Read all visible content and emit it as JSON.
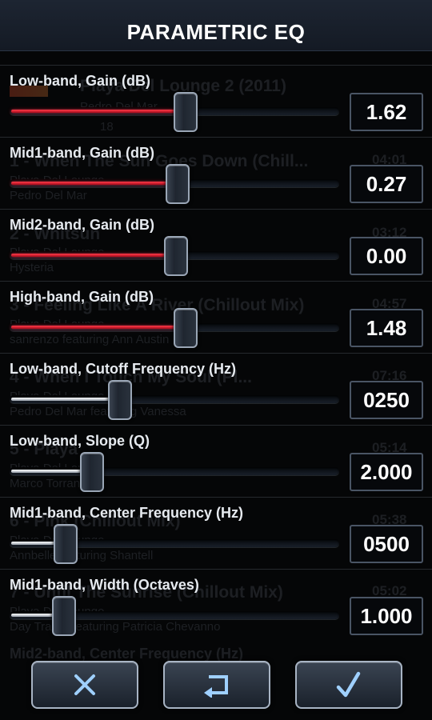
{
  "header": {
    "title": "PARAMETRIC EQ"
  },
  "background_playlist": {
    "album": "Playa Del Lounge 2 (2011)",
    "album_meta_1": "Pedro Del Mar",
    "album_meta_2": "18",
    "tracks": [
      {
        "title": "1 - When The Sun Goes Down (Chill...",
        "line2": "Playa Del Lounge",
        "artist": "Pedro Del Mar",
        "duration": "04:01"
      },
      {
        "title": "2 - Whitsun",
        "line2": "Playa Del Lounge",
        "artist": "Hysteria",
        "duration": "03:12"
      },
      {
        "title": "3 - Feeling Like A River (Chillout Mix)",
        "line2": "Playa Del Lounge",
        "artist": "sanrenzo featuring Ann Austin",
        "duration": "04:57"
      },
      {
        "title": "4 - When I Touch My Soul (Pl...",
        "line2": "Playa Del Lounge",
        "artist": "Pedro Del Mar featuring Vanessa",
        "duration": "07:16"
      },
      {
        "title": "5 - Playa",
        "line2": "Playa Del Lounge",
        "artist": "Marco Torrance",
        "duration": "05:14"
      },
      {
        "title": "6 - Pink (Chillout Mix)",
        "line2": "Playa Del Lounge",
        "artist": "Annbelle featuring Shantell",
        "duration": "05:38"
      },
      {
        "title": "7 - Until The Sunrise (Chillout Mix)",
        "line2": "Playa Del Lounge",
        "artist": "Day Trader featuring Patricia Chevanno",
        "duration": "05:02"
      }
    ],
    "next_band_label": "Mid2-band, Center Frequency (Hz)"
  },
  "bands": [
    {
      "label": "Low-band, Gain (dB)",
      "value": "1.62",
      "position": 0.53,
      "fill": "red"
    },
    {
      "label": "Mid1-band, Gain (dB)",
      "value": "0.27",
      "position": 0.505,
      "fill": "red"
    },
    {
      "label": "Mid2-band, Gain (dB)",
      "value": "0.00",
      "position": 0.5,
      "fill": "red"
    },
    {
      "label": "High-band, Gain (dB)",
      "value": "1.48",
      "position": 0.53,
      "fill": "red"
    },
    {
      "label": "Low-band, Cutoff Frequency (Hz)",
      "value": "0250",
      "position": 0.33,
      "fill": "white"
    },
    {
      "label": "Low-band, Slope (Q)",
      "value": "2.000",
      "position": 0.245,
      "fill": "white"
    },
    {
      "label": "Mid1-band, Center Frequency (Hz)",
      "value": "0500",
      "position": 0.165,
      "fill": "white"
    },
    {
      "label": "Mid1-band, Width (Octaves)",
      "value": "1.000",
      "position": 0.16,
      "fill": "white"
    }
  ],
  "footer": {
    "cancel_icon": "close-icon",
    "reset_icon": "undo-icon",
    "confirm_icon": "check-icon"
  },
  "colors": {
    "accent_red": "#e8192f",
    "header_bg": "#1a2230"
  }
}
